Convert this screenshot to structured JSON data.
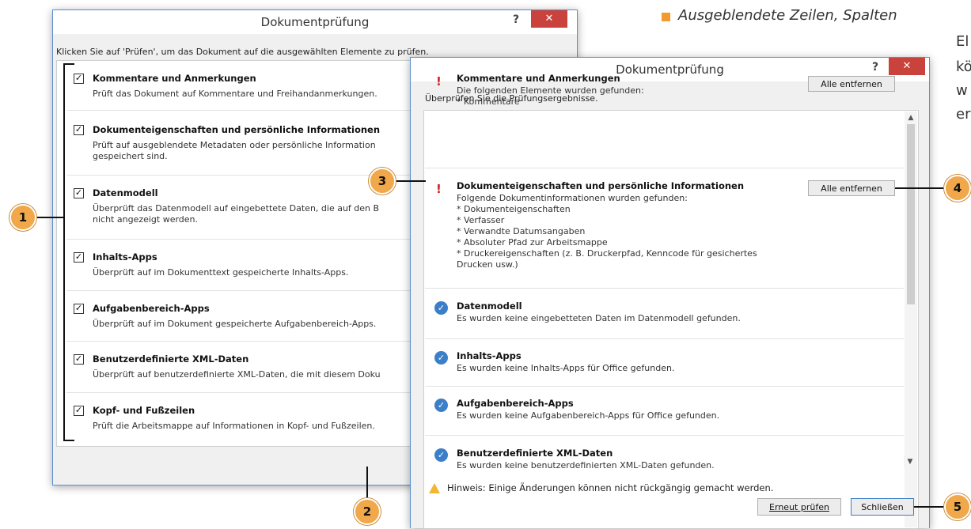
{
  "book_text": {
    "bullet_heading": "Ausgeblendete Zeilen, Spalten",
    "side_fragment": [
      "El",
      "kö",
      "w",
      "er"
    ]
  },
  "dialog1": {
    "title": "Dokumentprüfung",
    "help": "?",
    "close": "✕",
    "instruction": "Klicken Sie auf 'Prüfen', um das Dokument auf die ausgewählten Elemente zu prüfen.",
    "items": [
      {
        "title": "Kommentare und Anmerkungen",
        "desc": "Prüft das Dokument auf Kommentare und Freihandanmerkungen."
      },
      {
        "title": "Dokumenteigenschaften und persönliche Informationen",
        "desc": "Prüft auf ausgeblendete Metadaten oder persönliche Information",
        "desc2": "gespeichert sind."
      },
      {
        "title": "Datenmodell",
        "desc": "Überprüft das Datenmodell auf eingebettete Daten, die auf den B",
        "desc2": "nicht angezeigt werden."
      },
      {
        "title": "Inhalts-Apps",
        "desc": "Überprüft auf im Dokumenttext gespeicherte Inhalts-Apps."
      },
      {
        "title": "Aufgabenbereich-Apps",
        "desc": "Überprüft auf im Dokument gespeicherte Aufgabenbereich-Apps."
      },
      {
        "title": "Benutzerdefinierte XML-Daten",
        "desc": "Überprüft auf benutzerdefinierte XML-Daten, die mit diesem Doku"
      },
      {
        "title": "Kopf- und Fußzeilen",
        "desc": "Prüft die Arbeitsmappe auf Informationen in Kopf- und Fußzeilen."
      }
    ]
  },
  "dialog2": {
    "title": "Dokumentprüfung",
    "help": "?",
    "close": "✕",
    "instruction": "Überprüfen Sie die Prüfungsergebnisse.",
    "results": [
      {
        "title": "Kommentare und Anmerkungen",
        "lines": [
          "Die folgenden Elemente wurden gefunden:",
          "* Kommentare"
        ],
        "button": "Alle entfernen"
      },
      {
        "title": "Dokumenteigenschaften und persönliche Informationen",
        "lines": [
          "Folgende Dokumentinformationen wurden gefunden:",
          "* Dokumenteigenschaften",
          "* Verfasser",
          "* Verwandte Datumsangaben",
          "* Absoluter Pfad zur Arbeitsmappe",
          "* Druckereigenschaften (z. B. Druckerpfad, Kenncode für gesichertes",
          "Drucken usw.)"
        ],
        "button": "Alle entfernen"
      },
      {
        "title": "Datenmodell",
        "lines": [
          "Es wurden keine eingebetteten Daten im Datenmodell gefunden."
        ]
      },
      {
        "title": "Inhalts-Apps",
        "lines": [
          "Es wurden keine Inhalts-Apps für Office gefunden."
        ]
      },
      {
        "title": "Aufgabenbereich-Apps",
        "lines": [
          "Es wurden keine Aufgabenbereich-Apps für Office gefunden."
        ]
      },
      {
        "title": "Benutzerdefinierte XML-Daten",
        "lines": [
          "Es wurden keine benutzerdefinierten XML-Daten gefunden."
        ]
      }
    ],
    "warning": "Hinweis: Einige Änderungen können nicht rückgängig gemacht werden.",
    "recheck_button": "Erneut prüfen",
    "close_button": "Schließen"
  },
  "callouts": [
    "1",
    "2",
    "3",
    "4",
    "5"
  ],
  "colors": {
    "accent": "#f0a84a",
    "close_red": "#c9423b",
    "bullet": "#f29a2e",
    "ok_blue": "#3c7fc9",
    "warn_red": "#d42020"
  }
}
